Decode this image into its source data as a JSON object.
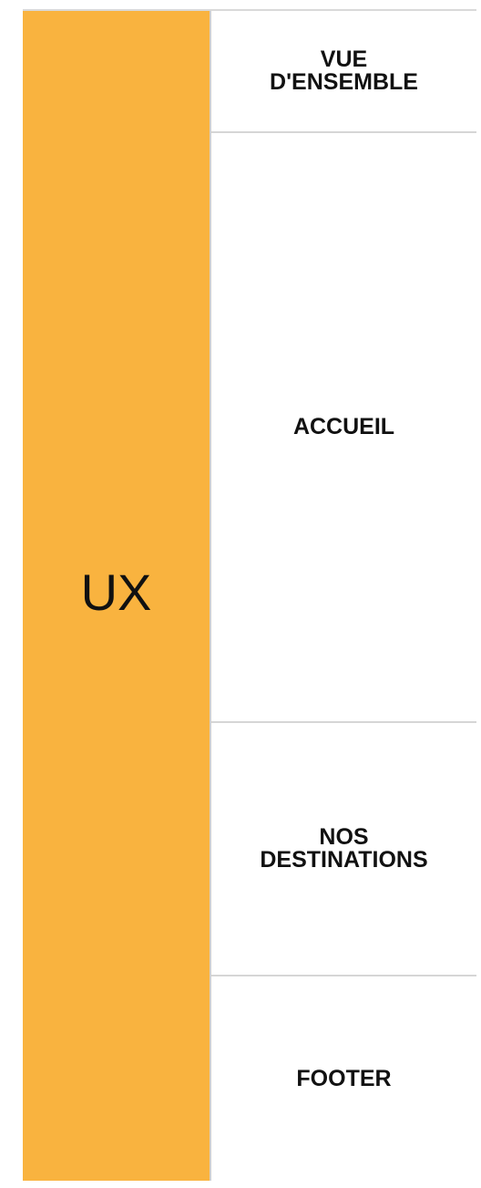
{
  "table": {
    "category": "UX",
    "sections": [
      {
        "label": "VUE\nD'ENSEMBLE"
      },
      {
        "label": "ACCUEIL"
      },
      {
        "label": "NOS\nDESTINATIONS"
      },
      {
        "label": "FOOTER"
      }
    ]
  },
  "colors": {
    "category_background": "#f9b33f",
    "text": "#111111",
    "divider": "#d6d6d6"
  }
}
